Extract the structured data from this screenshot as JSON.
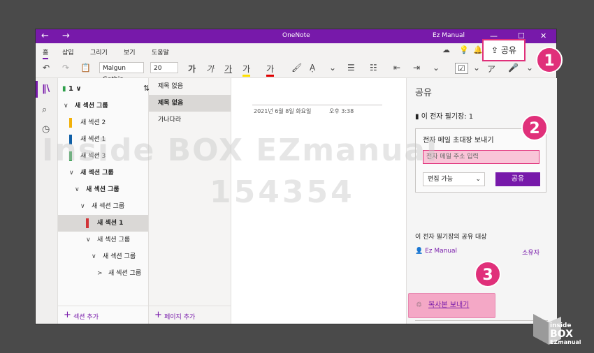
{
  "window": {
    "title": "OneNote",
    "user": "Ez Manual",
    "min": "—",
    "max": "☐",
    "close": "✕",
    "back": "←",
    "forward": "→"
  },
  "menu": [
    "홈",
    "삽입",
    "그리기",
    "보기",
    "도움말"
  ],
  "toolbar": {
    "font_name": "Malgun Gothic",
    "font_size": "20",
    "bold": "가",
    "italic": "가",
    "underline": "가",
    "color_a": "가",
    "color_b": "가"
  },
  "notebook": {
    "name": "1"
  },
  "sections": [
    {
      "label": "새 섹션 그룹",
      "kind": "group",
      "chev": "∨"
    },
    {
      "label": "새 섹션 2",
      "kind": "section",
      "color": "#f2b10a"
    },
    {
      "label": "새 섹션 1",
      "kind": "section",
      "color": "#0f5fa6"
    },
    {
      "label": "새 섹션 3",
      "kind": "section",
      "color": "#2e9f4b"
    },
    {
      "label": "새 섹션 그룹",
      "kind": "group",
      "chev": "∨"
    },
    {
      "label": "새 섹션 그룹",
      "kind": "group",
      "chev": "∨"
    },
    {
      "label": "새 섹션 그룹",
      "kind": "group",
      "chev": "∨"
    },
    {
      "label": "새 섹션 1",
      "kind": "section",
      "color": "#d13438",
      "selected": true
    },
    {
      "label": "새 섹션 그룹",
      "kind": "group",
      "chev": "∨"
    },
    {
      "label": "새 섹션 그룹",
      "kind": "group",
      "chev": "∨"
    },
    {
      "label": "새 섹션 그룹",
      "kind": "group",
      "chev": ">"
    }
  ],
  "add_section": "섹션 추가",
  "pages": [
    {
      "label": "제목 없음"
    },
    {
      "label": "제목 없음",
      "selected": true
    },
    {
      "label": "가나다라"
    }
  ],
  "add_page": "페이지 추가",
  "canvas": {
    "date": "2021년 6월 8일 화요일",
    "time": "오후 3:38"
  },
  "share": {
    "title": "공유",
    "notebook_info": "이 전자 필기장: 1",
    "invite_title": "전자 메일 초대장 보내기",
    "email_placeholder": "전자 메일 주소 입력",
    "permission": "편집 가능",
    "share_button": "공유",
    "shared_with": "이 전자 필기장의 공유 대상",
    "user_name": "Ez Manual",
    "user_role": "소유자",
    "send_copy": "복사본 보내기"
  },
  "share_top_button": "공유",
  "badges": [
    "1",
    "2",
    "3"
  ],
  "watermark": {
    "line1": "Inside BOX EZmanual",
    "line2": "154354"
  },
  "logo": {
    "l1": "inside",
    "l2": "BOX",
    "l3": "EZmanual"
  }
}
